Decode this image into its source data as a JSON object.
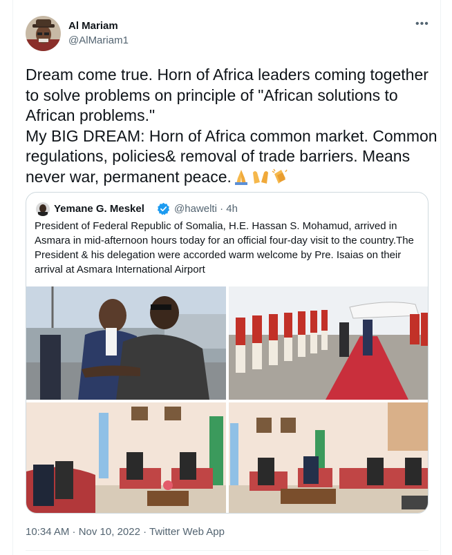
{
  "author": {
    "display_name": "Al Mariam",
    "handle": "@AlMariam1"
  },
  "tweet": {
    "text": "Dream come true. Horn of Africa leaders coming together to solve problems on principle of \"African solutions to African problems.\"\nMy BIG DREAM: Horn of Africa common market. Common regulations, policies& removal of trade barriers. Means never war, permanent peace.",
    "emojis": [
      "folded-hands-icon",
      "open-hands-icon",
      "clapping-hands-icon"
    ]
  },
  "quoted_tweet": {
    "display_name": "Yemane G. Meskel",
    "verified": true,
    "handle_time": "@hawelti · 4h",
    "text": "President of Federal Republic of Somalia, H.E. Hassan S. Mohamud, arrived in Asmara in mid-afternoon hours today for an official four-day visit to the country.The President & his delegation were accorded warm welcome by Pre. Isaias on their arrival at Asmara International Airport",
    "photos": [
      "airport-embrace-photo",
      "guard-of-honour-photo",
      "meeting-room-photo-left",
      "meeting-room-photo-right"
    ]
  },
  "footer": {
    "timestamp": "10:34 AM · Nov 10, 2022 · Twitter Web App"
  },
  "colors": {
    "text": "#0f1419",
    "secondary": "#536471",
    "border": "#cfd9de",
    "verified": "#1d9bf0"
  }
}
